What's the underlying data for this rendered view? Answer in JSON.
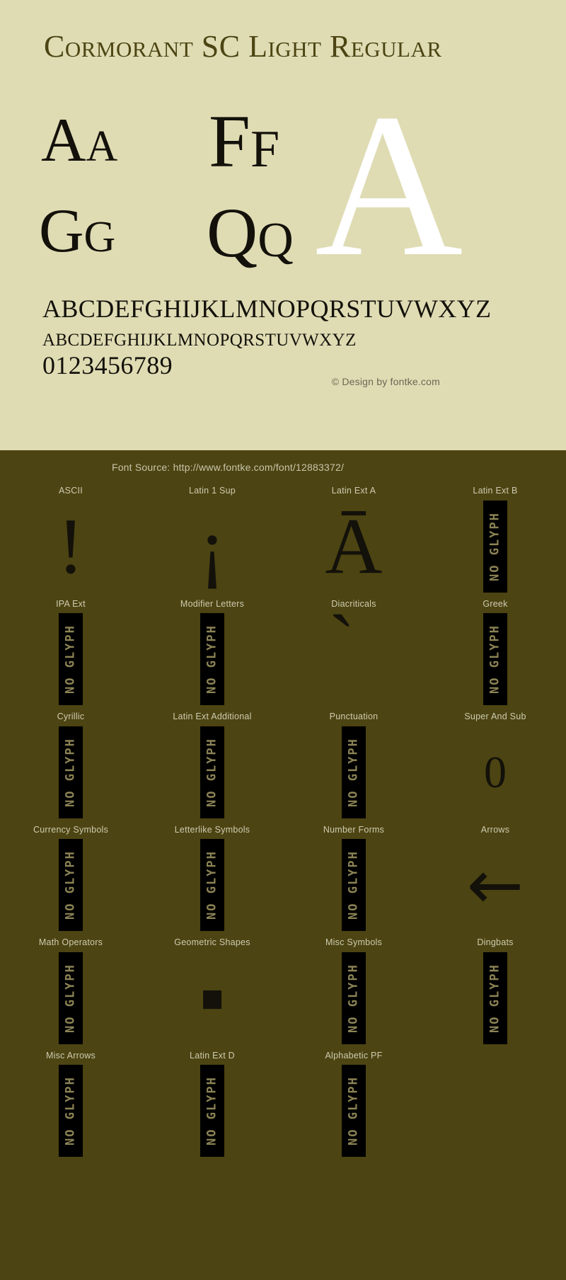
{
  "specimen": {
    "title": "Cormorant SC Light Regular",
    "big_letter": "A",
    "pairs": [
      {
        "name": "aa",
        "text": "Aa"
      },
      {
        "name": "ff",
        "text": "Ff"
      },
      {
        "name": "gg",
        "text": "Gg"
      },
      {
        "name": "qq",
        "text": "Qq"
      }
    ],
    "alphabet_upper": "ABCDEFGHIJKLMNOPQRSTUVWXYZ",
    "alphabet_lower": "abcdefghijklmnopqrstuvwxyz",
    "digits": "0123456789",
    "credit": "© Design by fontke.com",
    "background_color": "#dfdcb4",
    "text_color": "#13110a",
    "title_color": "#4c4412"
  },
  "dark_panel": {
    "source": "Font Source: http://www.fontke.com/font/12883372/",
    "background_color": "#4c4412",
    "label_color": "#cfcbb1",
    "no_glyph_text": "NO GLYPH",
    "rows": [
      {
        "cells": [
          {
            "label": "ASCII",
            "kind": "glyph",
            "glyph": "!",
            "style": "g-excl"
          },
          {
            "label": "Latin 1 Sup",
            "kind": "glyph",
            "glyph": "¡",
            "style": "g-iexcl"
          },
          {
            "label": "Latin Ext A",
            "kind": "glyph",
            "glyph": "Ā",
            "style": "g-amac"
          },
          {
            "label": "Latin Ext B",
            "kind": "no-glyph",
            "glyph": "",
            "style": ""
          }
        ]
      },
      {
        "cells": [
          {
            "label": "IPA Ext",
            "kind": "no-glyph",
            "glyph": "",
            "style": ""
          },
          {
            "label": "Modifier Letters",
            "kind": "no-glyph",
            "glyph": "",
            "style": ""
          },
          {
            "label": "Diacriticals",
            "kind": "glyph",
            "glyph": "̀",
            "style": "g-grave"
          },
          {
            "label": "Greek",
            "kind": "no-glyph",
            "glyph": "",
            "style": ""
          }
        ]
      },
      {
        "cells": [
          {
            "label": "Cyrillic",
            "kind": "no-glyph",
            "glyph": "",
            "style": ""
          },
          {
            "label": "Latin Ext Additional",
            "kind": "no-glyph",
            "glyph": "",
            "style": ""
          },
          {
            "label": "Punctuation",
            "kind": "no-glyph",
            "glyph": "",
            "style": ""
          },
          {
            "label": "Super And Sub",
            "kind": "glyph",
            "glyph": "0",
            "style": "g-zero"
          }
        ]
      },
      {
        "cells": [
          {
            "label": "Currency Symbols",
            "kind": "no-glyph",
            "glyph": "",
            "style": ""
          },
          {
            "label": "Letterlike Symbols",
            "kind": "no-glyph",
            "glyph": "",
            "style": ""
          },
          {
            "label": "Number Forms",
            "kind": "no-glyph",
            "glyph": "",
            "style": ""
          },
          {
            "label": "Arrows",
            "kind": "glyph",
            "glyph": "←",
            "style": "g-arrow"
          }
        ]
      },
      {
        "cells": [
          {
            "label": "Math Operators",
            "kind": "no-glyph",
            "glyph": "",
            "style": ""
          },
          {
            "label": "Geometric Shapes",
            "kind": "glyph",
            "glyph": "■",
            "style": "g-square"
          },
          {
            "label": "Misc Symbols",
            "kind": "no-glyph",
            "glyph": "",
            "style": ""
          },
          {
            "label": "Dingbats",
            "kind": "no-glyph",
            "glyph": "",
            "style": ""
          }
        ]
      },
      {
        "cells": [
          {
            "label": "Misc Arrows",
            "kind": "no-glyph",
            "glyph": "",
            "style": ""
          },
          {
            "label": "Latin Ext D",
            "kind": "no-glyph",
            "glyph": "",
            "style": ""
          },
          {
            "label": "Alphabetic PF",
            "kind": "no-glyph",
            "glyph": "",
            "style": ""
          },
          {
            "label": "",
            "kind": "empty",
            "glyph": "",
            "style": ""
          }
        ]
      }
    ]
  }
}
